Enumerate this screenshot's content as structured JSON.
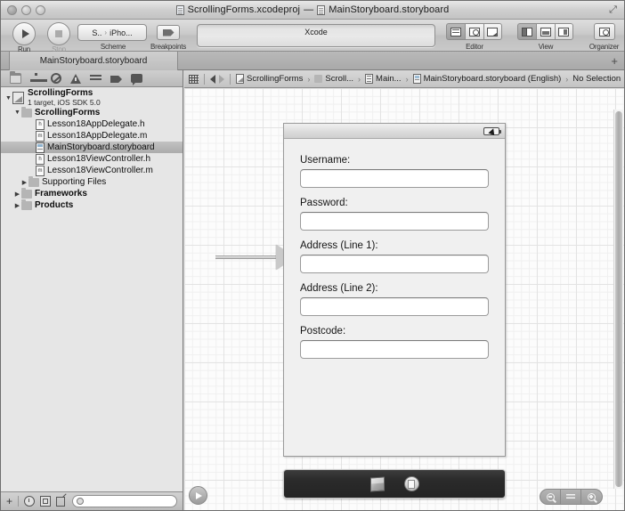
{
  "window": {
    "title_project": "ScrollingForms.xcodeproj",
    "title_dash": "—",
    "title_file": "MainStoryboard.storyboard",
    "expand_icon": "expand-icon"
  },
  "toolbar": {
    "run_label": "Run",
    "stop_label": "Stop",
    "scheme_label": "Scheme",
    "scheme_value_left": "S..",
    "scheme_value_right": "iPho...",
    "scheme_chevron": "›",
    "breakpoints_label": "Breakpoints",
    "status_text": "Xcode",
    "editor_label": "Editor",
    "view_label": "View",
    "organizer_label": "Organizer",
    "editor_segments": [
      "standard-editor",
      "assistant-editor",
      "version-editor"
    ],
    "view_segments": [
      "navigator-toggle",
      "debug-toggle",
      "utilities-toggle"
    ]
  },
  "tabbar": {
    "active_tab": "MainStoryboard.storyboard",
    "add_tab": "+"
  },
  "navigator": {
    "toolbar_icons": [
      "project-navigator-icon",
      "symbol-navigator-icon",
      "search-navigator-icon",
      "issue-navigator-icon",
      "test-navigator-icon",
      "debug-navigator-icon",
      "breakpoint-navigator-icon",
      "log-navigator-icon"
    ],
    "tree": [
      {
        "label": "ScrollingForms",
        "sub": "1 target, iOS SDK 5.0",
        "indent": 0,
        "icon": "project-icon",
        "twisty": "▼",
        "selected": false,
        "bold": true
      },
      {
        "label": "ScrollingForms",
        "sub": "",
        "indent": 1,
        "icon": "folder-icon",
        "twisty": "▼",
        "selected": false,
        "bold": true
      },
      {
        "label": "Lesson18AppDelegate.h",
        "sub": "",
        "indent": 2,
        "icon": "header-file-icon",
        "twisty": "",
        "selected": false,
        "bold": false
      },
      {
        "label": "Lesson18AppDelegate.m",
        "sub": "",
        "indent": 2,
        "icon": "source-file-icon",
        "twisty": "",
        "selected": false,
        "bold": false
      },
      {
        "label": "MainStoryboard.storyboard",
        "sub": "",
        "indent": 2,
        "icon": "storyboard-file-icon",
        "twisty": "",
        "selected": true,
        "bold": false
      },
      {
        "label": "Lesson18ViewController.h",
        "sub": "",
        "indent": 2,
        "icon": "header-file-icon",
        "twisty": "",
        "selected": false,
        "bold": false
      },
      {
        "label": "Lesson18ViewController.m",
        "sub": "",
        "indent": 2,
        "icon": "source-file-icon",
        "twisty": "",
        "selected": false,
        "bold": false
      },
      {
        "label": "Supporting Files",
        "sub": "",
        "indent": 2,
        "icon": "folder-icon",
        "twisty": "▶",
        "selected": false,
        "bold": false
      },
      {
        "label": "Frameworks",
        "sub": "",
        "indent": 1,
        "icon": "folder-icon",
        "twisty": "▶",
        "selected": false,
        "bold": true
      },
      {
        "label": "Products",
        "sub": "",
        "indent": 1,
        "icon": "folder-icon",
        "twisty": "▶",
        "selected": false,
        "bold": true
      }
    ],
    "filter": {
      "add_label": "+",
      "recent_icon": "recent-files-icon",
      "source_icon": "source-control-icon",
      "unsaved_icon": "unsaved-files-icon",
      "search_placeholder": ""
    }
  },
  "jumpbar": {
    "grid_icon": "related-items-icon",
    "back_icon": "back-arrow-icon",
    "forward_icon": "forward-arrow-icon",
    "crumbs": [
      {
        "label": "ScrollingForms",
        "icon": "project-icon"
      },
      {
        "label": "Scroll...",
        "icon": "folder-icon"
      },
      {
        "label": "Main...",
        "icon": "source-file-icon"
      },
      {
        "label": "MainStoryboard.storyboard (English)",
        "icon": "storyboard-file-icon"
      },
      {
        "label": "No Selection",
        "icon": ""
      }
    ],
    "separator": "›"
  },
  "canvas": {
    "device": {
      "status_bar_battery_icon": "battery-charging-icon",
      "fields": [
        {
          "label": "Username:",
          "value": "",
          "name": "username-field"
        },
        {
          "label": "Password:",
          "value": "",
          "name": "password-field"
        },
        {
          "label": "Address (Line 1):",
          "value": "",
          "name": "address-line1-field"
        },
        {
          "label": "Address (Line 2):",
          "value": "",
          "name": "address-line2-field"
        },
        {
          "label": "Postcode:",
          "value": "",
          "name": "postcode-field"
        }
      ]
    },
    "dock": {
      "items": [
        "first-responder-icon",
        "view-controller-icon"
      ]
    },
    "annotation_arrow": "callout-arrow",
    "play_button": "animation-play-button",
    "zoom_controls": [
      "zoom-out-icon",
      "zoom-fit-icon",
      "zoom-in-icon"
    ]
  }
}
